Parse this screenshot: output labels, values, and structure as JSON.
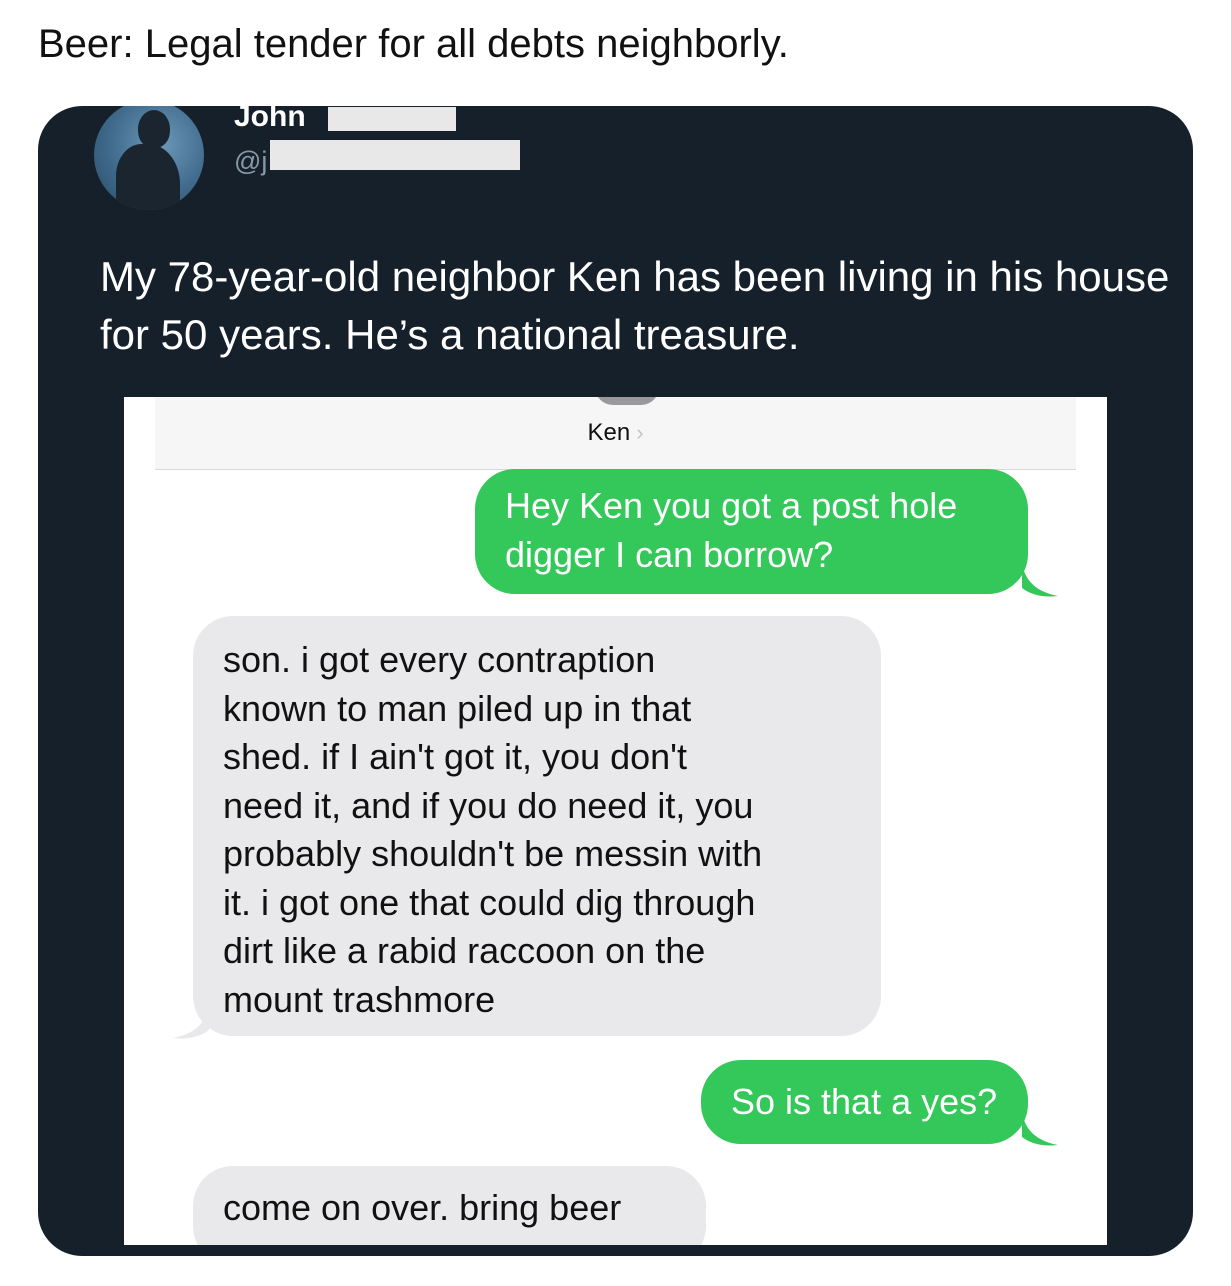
{
  "caption": "Beer: Legal tender for all debts neighborly.",
  "tweet": {
    "display_name": "John",
    "handle": "@j",
    "text": "My 78-year-old neighbor Ken has been living in his house for 50 years. He’s a national treasure."
  },
  "conversation": {
    "contact_name": "Ken",
    "chevron": "›",
    "messages": [
      {
        "direction": "sent",
        "text": "Hey Ken you got a post hole\ndigger I can borrow?"
      },
      {
        "direction": "received",
        "text": "son. i got every contraption\nknown to man piled up in that\nshed. if I ain't got it, you don't\nneed it, and if you do need it, you\nprobably shouldn't be messin with\nit. i got one that could dig through\ndirt like a rabid raccoon on the\nmount trashmore"
      },
      {
        "direction": "sent",
        "text": "So is that a yes?"
      },
      {
        "direction": "received",
        "text": "come on over. bring beer"
      }
    ]
  },
  "colors": {
    "tweet_background": "#15202b",
    "sent_bubble": "#34c759",
    "received_bubble": "#e9e9eb"
  }
}
